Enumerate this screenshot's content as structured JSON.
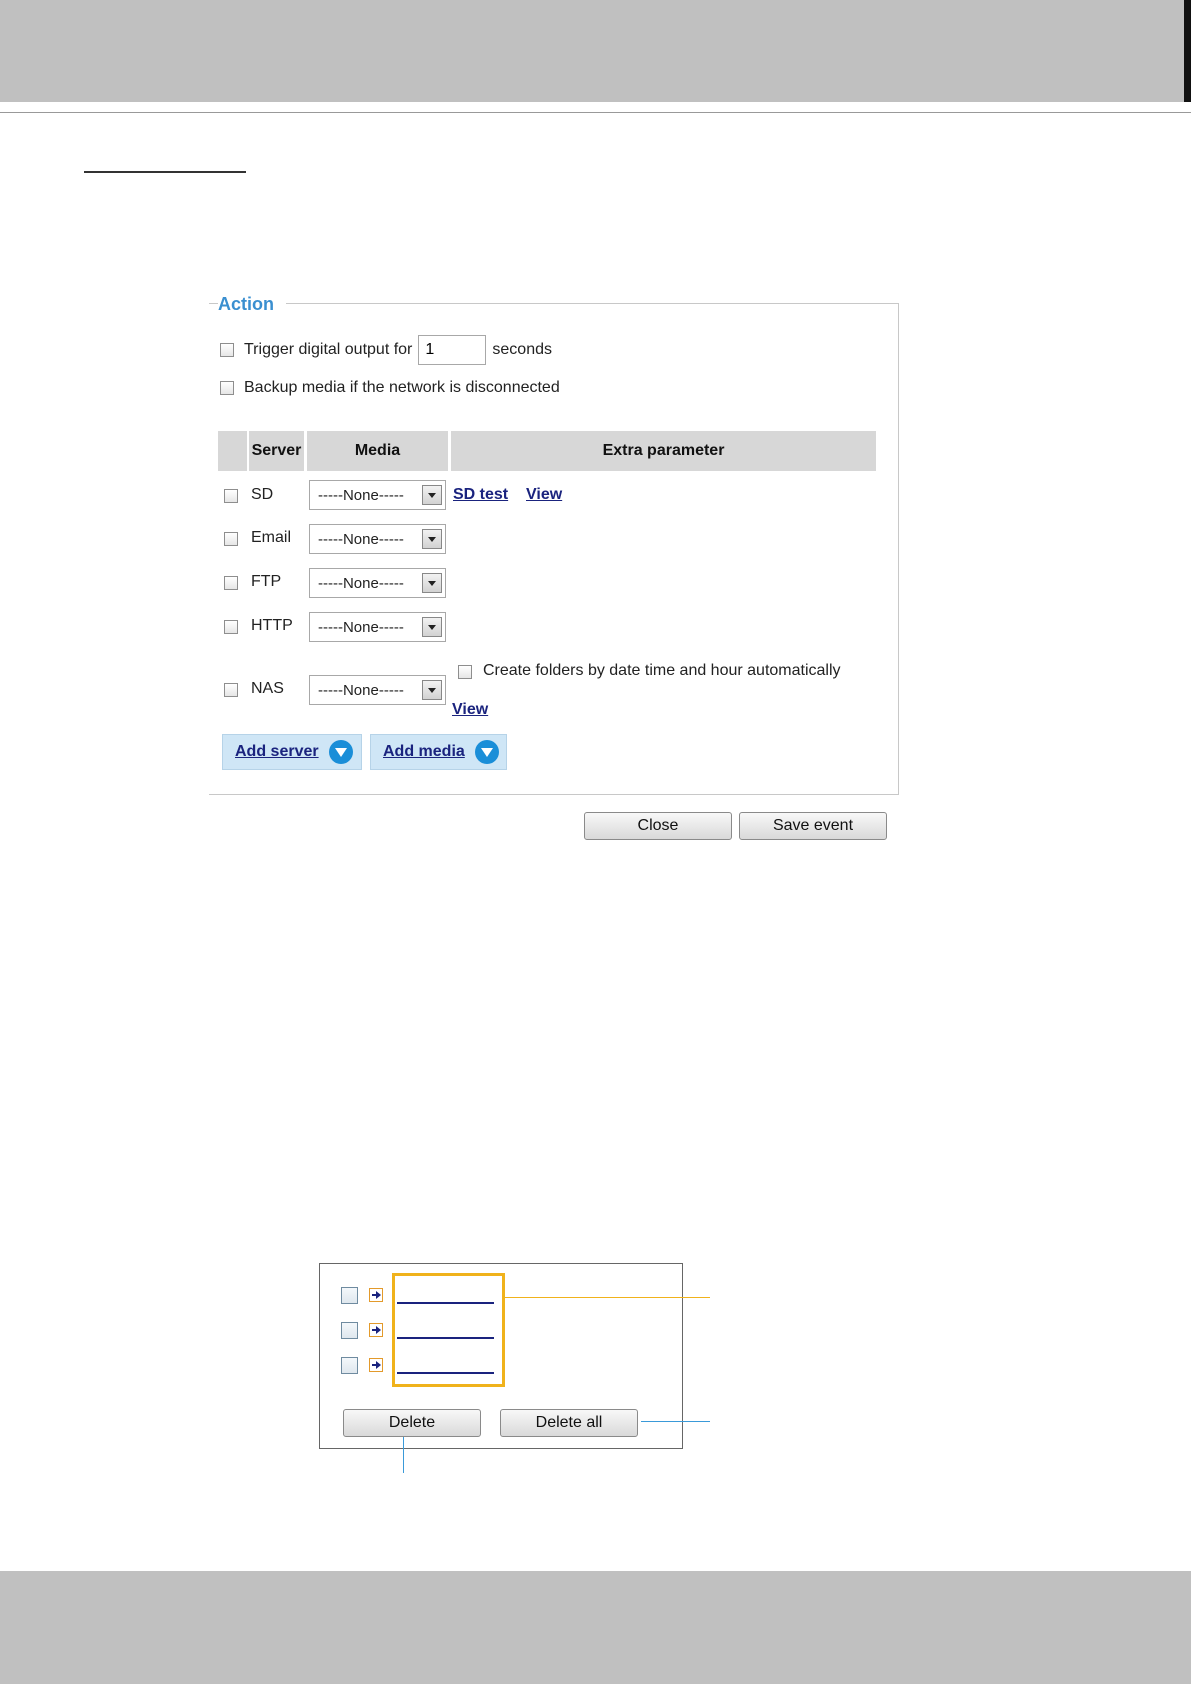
{
  "action": {
    "legend": "Action",
    "trigger_checkbox_label": "Trigger digital output for",
    "trigger_value": "1",
    "trigger_unit": "seconds",
    "backup_label": "Backup media if the network is disconnected",
    "table_headers": {
      "server": "Server",
      "media": "Media",
      "extra": "Extra parameter"
    },
    "rows": [
      {
        "server": "SD",
        "media": "-----None-----",
        "links": [
          "SD test",
          "View"
        ]
      },
      {
        "server": "Email",
        "media": "-----None-----"
      },
      {
        "server": "FTP",
        "media": "-----None-----"
      },
      {
        "server": "HTTP",
        "media": "-----None-----"
      },
      {
        "server": "NAS",
        "media": "-----None-----",
        "create_folders_label": "Create folders by date time and hour automatically",
        "view_link": "View"
      }
    ],
    "add_server_label": "Add server",
    "add_media_label": "Add media",
    "close_label": "Close",
    "save_event_label": "Save event"
  },
  "list_panel": {
    "delete_label": "Delete",
    "delete_all_label": "Delete all",
    "highlight_color": "#f0b21b",
    "callout_colors": [
      "#f0b21b",
      "#3a9ad9"
    ]
  }
}
